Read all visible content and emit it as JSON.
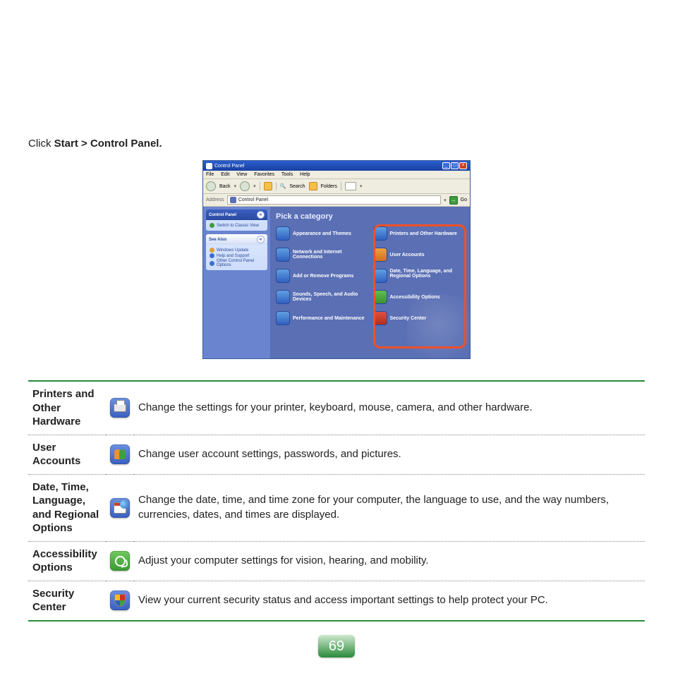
{
  "instruction": {
    "prefix": "Click ",
    "bold": "Start > Control Panel."
  },
  "xp": {
    "title": "Control Panel",
    "menu": [
      "File",
      "Edit",
      "View",
      "Favorites",
      "Tools",
      "Help"
    ],
    "toolbar": {
      "back": "Back",
      "search": "Search",
      "folders": "Folders"
    },
    "address": {
      "label": "Address",
      "value": "Control Panel",
      "go": "Go"
    },
    "sidebar": {
      "panel1": {
        "title": "Control Panel",
        "links": [
          "Switch to Classic View"
        ]
      },
      "panel2": {
        "title": "See Also",
        "links": [
          "Windows Update",
          "Help and Support",
          "Other Control Panel Options"
        ]
      }
    },
    "heading": "Pick a category",
    "col_left": [
      "Appearance and Themes",
      "Network and Internet Connections",
      "Add or Remove Programs",
      "Sounds, Speech, and Audio Devices",
      "Performance and Maintenance"
    ],
    "col_right": [
      "Printers and Other Hardware",
      "User Accounts",
      "Date, Time, Language, and Regional Options",
      "Accessibility Options",
      "Security Center"
    ]
  },
  "table": [
    {
      "term": "Printers and Other Hardware",
      "icon": "printer",
      "desc": "Change the settings for your printer, keyboard, mouse, camera, and other hardware."
    },
    {
      "term": "User Accounts",
      "icon": "users",
      "desc": "Change user account settings, passwords, and pictures."
    },
    {
      "term": "Date, Time, Language, and Regional Options",
      "icon": "date",
      "desc": "Change the date, time, and time zone for your computer, the language to use, and the way numbers, currencies, dates, and times are displayed."
    },
    {
      "term": "Accessibility Options",
      "icon": "access",
      "desc": "Adjust your computer settings for vision, hearing, and mobility."
    },
    {
      "term": "Security Center",
      "icon": "security",
      "desc": "View your current security status and access important settings to help protect your PC."
    }
  ],
  "page_number": "69"
}
